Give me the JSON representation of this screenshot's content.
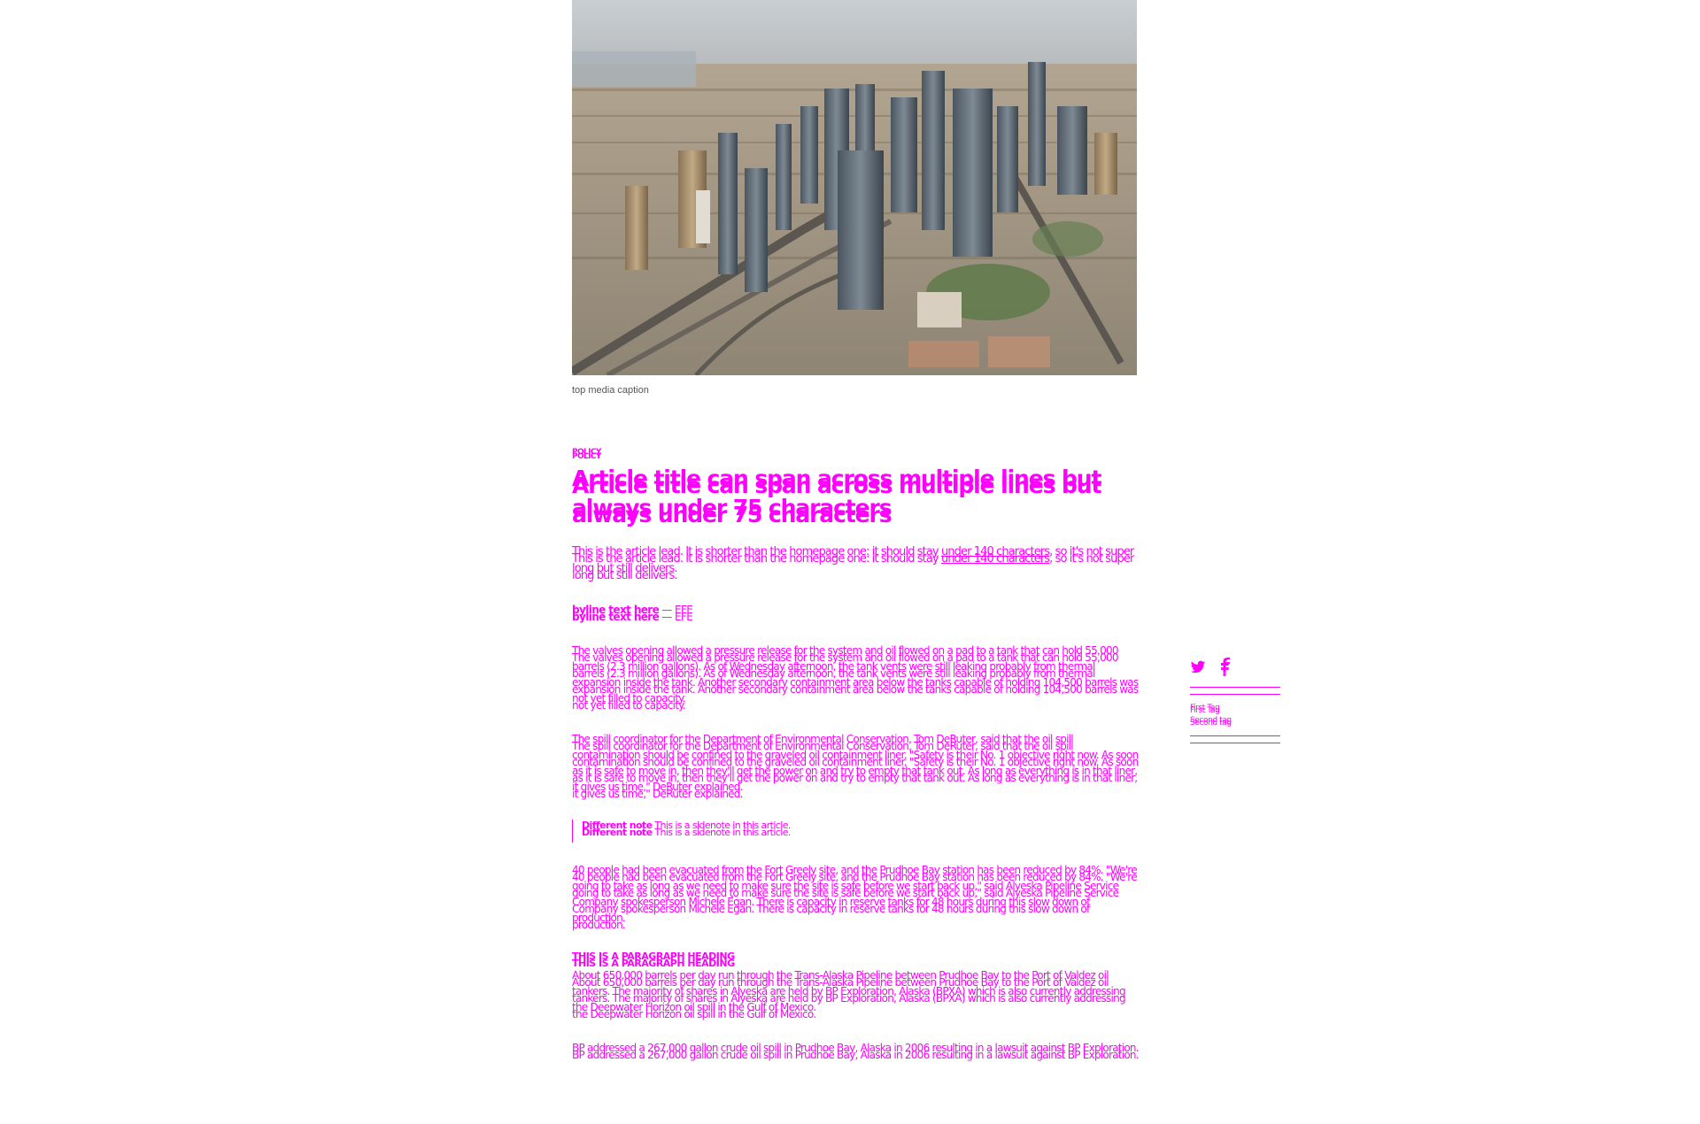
{
  "hero": {
    "image_alt": "aerial city skyline with skyscrapers and highways",
    "caption": "top media caption"
  },
  "article": {
    "section": "POLICY",
    "title": "Article title can span across multiple lines but always under 75 characters",
    "lead_plain": "This is the article lead. It is shorter than the homepage one: it should stay ",
    "lead_underlined": "under 140 characters",
    "lead_tail": ", so it's not super long but still delivers.",
    "byline_name": "byline text here",
    "byline_sep": " — EFE",
    "paragraphs": [
      "The valves opening allowed a pressure release for the system and oil flowed on a pad to a tank that can hold 55,000 barrels (2.3 million gallons). As of Wednesday afternoon, the tank vents were still leaking probably from thermal expansion inside the tank. Another secondary containment area below the tanks capable of holding 104,500 barrels was not yet filled to capacity.",
      "The spill coordinator for the Department of Environmental Conservation, Tom DeRuter, said that the oil spill contamination should be confined to the graveled oil containment liner. \"Safety is their No. 1 objective right now. As soon as it is safe to move in, then they'll get the power on and try to empty that tank out. As long as everything is in that liner, it gives us time,\" DeRuter explained."
    ],
    "sidenote_label": "Different note",
    "sidenote_text": " This is a sidenote in this article.",
    "paragraph_3": "40 people had been evacuated from the Fort Greely site, and the Prudhoe Bay station has been reduced by 84%. \"We're going to take as long as we need to make sure the site is safe before we start back up,\" said Alyeska Pipeline Service Company spokesperson Michele Egan. There is capacity in reserve tanks for 48 hours during this slow down of production.",
    "paragraph_heading": "THIS IS A PARAGRAPH HEADING",
    "paragraph_4": "About 650,000 barrels per day run through the Trans-Alaska Pipeline between Prudhoe Bay to the Port of Valdez oil tankers. The majority of shares in Alyeska are held by BP Exploration, Alaska (BPXA) which is also currently addressing the Deepwater Horizon oil spill in the Gulf of Mexico.",
    "paragraph_5": "BP addressed a 267,000 gallon crude oil spill in Prudhoe Bay, Alaska in 2006 resulting in a lawsuit against BP Exploration."
  },
  "share": {
    "icons": [
      "twitter-icon",
      "facebook-icon"
    ],
    "tags": [
      "First Tag",
      "Second tag"
    ]
  },
  "colors": {
    "accent": "#ff00ff",
    "caption": "#555555",
    "background": "#ffffff"
  }
}
